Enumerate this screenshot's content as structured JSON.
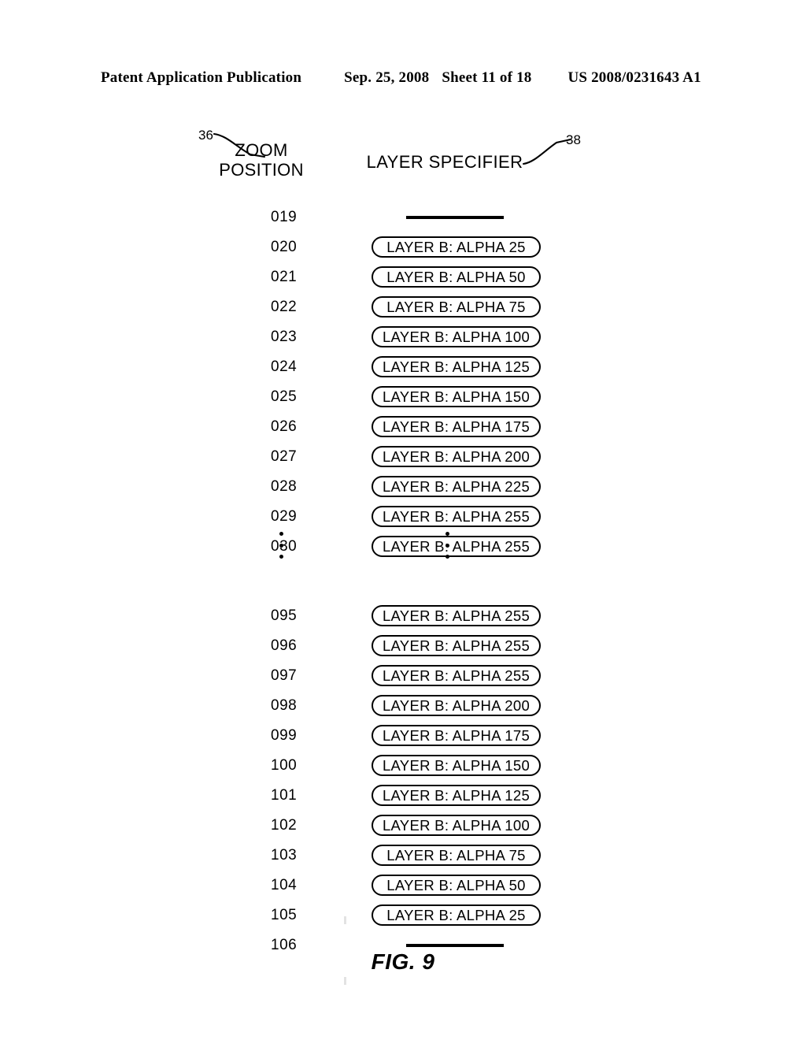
{
  "header": {
    "publication": "Patent Application Publication",
    "date": "Sep. 25, 2008",
    "sheet": "Sheet 11 of 18",
    "number": "US 2008/0231643 A1"
  },
  "figure": {
    "caption": "FIG. 9",
    "ref_zoom_position": "36",
    "ref_layer_specifier": "38",
    "zoom_heading_line1": "ZOOM",
    "zoom_heading_line2": "POSITION",
    "layer_heading": "LAYER SPECIFIER",
    "ellipsis_glyph": "⋮",
    "rows": [
      {
        "position": "019",
        "specifier": "",
        "kind": "bar"
      },
      {
        "position": "020",
        "specifier": "LAYER B:  ALPHA 25",
        "kind": "pill"
      },
      {
        "position": "021",
        "specifier": "LAYER B:  ALPHA 50",
        "kind": "pill"
      },
      {
        "position": "022",
        "specifier": "LAYER B:  ALPHA 75",
        "kind": "pill"
      },
      {
        "position": "023",
        "specifier": "LAYER B:  ALPHA 100",
        "kind": "pill"
      },
      {
        "position": "024",
        "specifier": "LAYER B:  ALPHA 125",
        "kind": "pill"
      },
      {
        "position": "025",
        "specifier": "LAYER B:  ALPHA 150",
        "kind": "pill"
      },
      {
        "position": "026",
        "specifier": "LAYER B:  ALPHA 175",
        "kind": "pill"
      },
      {
        "position": "027",
        "specifier": "LAYER B:  ALPHA 200",
        "kind": "pill"
      },
      {
        "position": "028",
        "specifier": "LAYER B:  ALPHA 225",
        "kind": "pill"
      },
      {
        "position": "029",
        "specifier": "LAYER B:  ALPHA 255",
        "kind": "pill"
      },
      {
        "position": "030",
        "specifier": "LAYER B:  ALPHA 255",
        "kind": "pill"
      },
      {
        "position": "095",
        "specifier": "LAYER B:  ALPHA 255",
        "kind": "pill"
      },
      {
        "position": "096",
        "specifier": "LAYER B:  ALPHA 255",
        "kind": "pill"
      },
      {
        "position": "097",
        "specifier": "LAYER B:  ALPHA 255",
        "kind": "pill"
      },
      {
        "position": "098",
        "specifier": "LAYER B:  ALPHA 200",
        "kind": "pill"
      },
      {
        "position": "099",
        "specifier": "LAYER B:  ALPHA 175",
        "kind": "pill"
      },
      {
        "position": "100",
        "specifier": "LAYER B:  ALPHA 150",
        "kind": "pill"
      },
      {
        "position": "101",
        "specifier": "LAYER B:  ALPHA 125",
        "kind": "pill"
      },
      {
        "position": "102",
        "specifier": "LAYER B:  ALPHA 100",
        "kind": "pill"
      },
      {
        "position": "103",
        "specifier": "LAYER B:  ALPHA 75",
        "kind": "pill"
      },
      {
        "position": "104",
        "specifier": "LAYER B:  ALPHA 50",
        "kind": "pill"
      },
      {
        "position": "105",
        "specifier": "LAYER B:  ALPHA 25",
        "kind": "pill"
      },
      {
        "position": "106",
        "specifier": "",
        "kind": "bar"
      }
    ]
  },
  "colors": {
    "ink": "#000000",
    "paper": "#ffffff"
  }
}
